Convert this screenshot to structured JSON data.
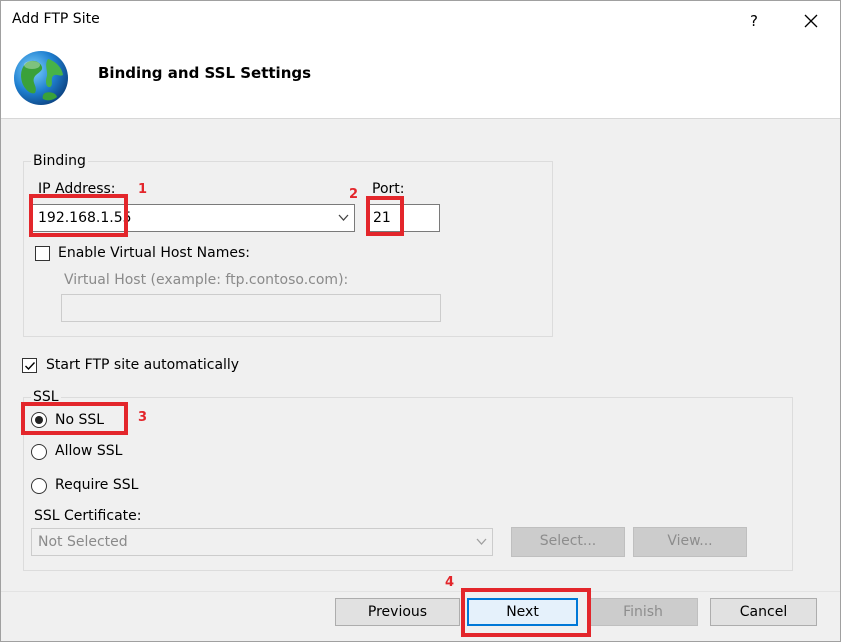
{
  "window": {
    "title": "Add FTP Site",
    "help_label": "?",
    "close_icon": "close-icon"
  },
  "header": {
    "title": "Binding and SSL Settings",
    "icon": "globe-icon"
  },
  "binding": {
    "legend": "Binding",
    "ip_label": "IP Address:",
    "ip_value": "192.168.1.55",
    "port_label": "Port:",
    "port_value": "21",
    "virtual_host_checkbox_label": "Enable Virtual Host Names:",
    "virtual_host_checked": false,
    "virtual_host_label": "Virtual Host (example: ftp.contoso.com):",
    "virtual_host_value": ""
  },
  "start_automatically": {
    "label": "Start FTP site automatically",
    "checked": true
  },
  "ssl": {
    "legend": "SSL",
    "options": [
      {
        "label": "No SSL",
        "selected": true
      },
      {
        "label": "Allow SSL",
        "selected": false
      },
      {
        "label": "Require SSL",
        "selected": false
      }
    ],
    "certificate_label": "SSL Certificate:",
    "certificate_value": "Not Selected",
    "select_button": "Select...",
    "view_button": "View..."
  },
  "footer": {
    "previous": "Previous",
    "next": "Next",
    "finish": "Finish",
    "cancel": "Cancel"
  },
  "annotations": {
    "marker_1": "1",
    "marker_2": "2",
    "marker_3": "3",
    "marker_4": "4",
    "color": "#e3262b"
  },
  "colors": {
    "accent": "#0078d7",
    "dialog_bg": "#f0f0f0",
    "header_bg": "#ffffff"
  }
}
